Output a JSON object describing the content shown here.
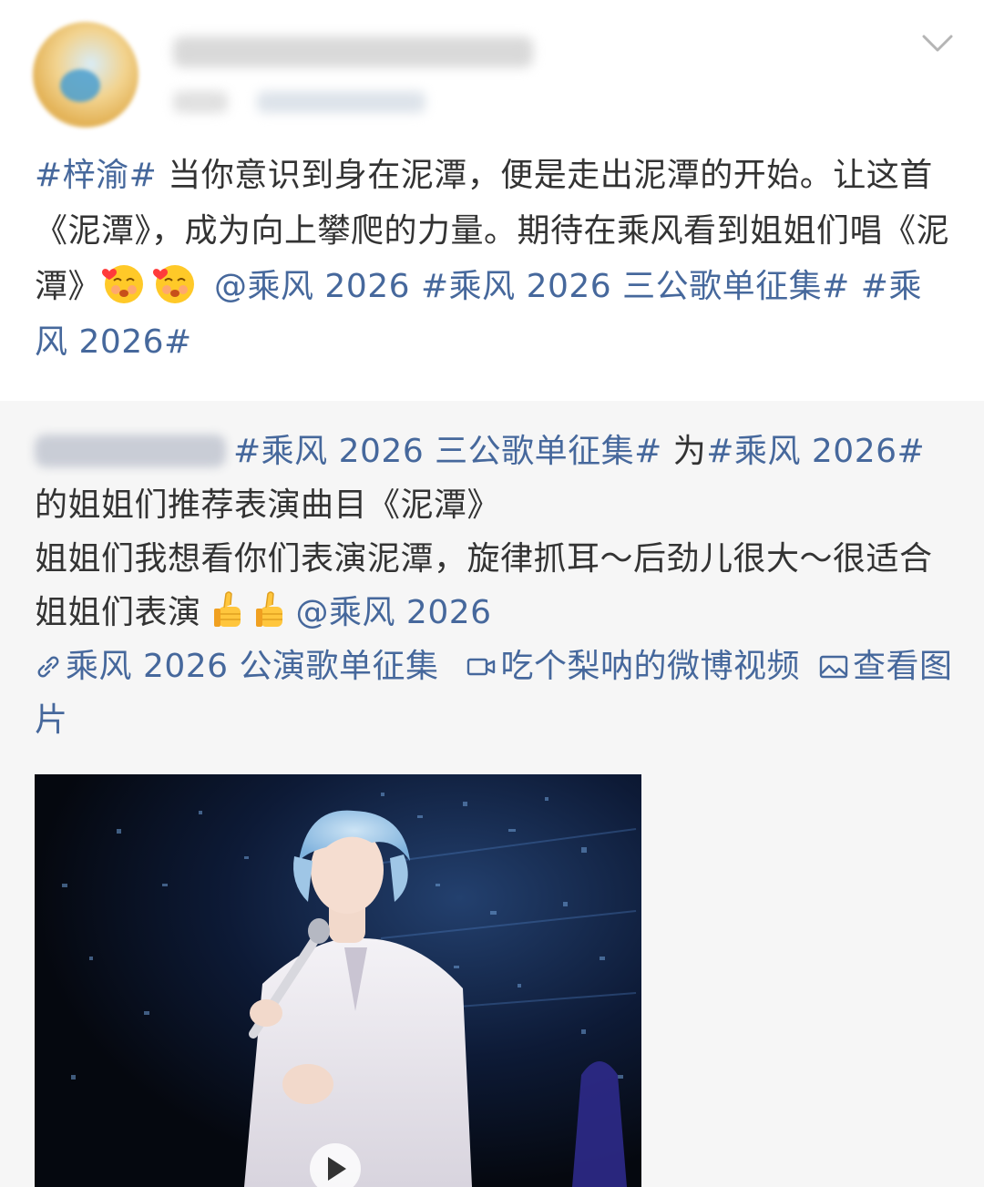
{
  "post": {
    "tag_ziyu": "#梓渝#",
    "text_1": " 当你意识到身在泥潭，便是走出泥潭的开始。让这首《泥潭》，成为向上攀爬的力量。期待在乘风看到姐姐们唱《泥潭》",
    "mention": "@乘风 2026",
    "tag_collection": "#乘风 2026 三公歌单征集#",
    "tag_show": "#乘风 2026#"
  },
  "repost": {
    "tag_collection": "#乘风 2026 三公歌单征集#",
    "text_for": " 为",
    "tag_show": "#乘风 2026#",
    "text_recommend": "的姐姐们推荐表演曲目《泥潭》",
    "text_wish": "姐姐们我想看你们表演泥潭，旋律抓耳～后劲儿很大～很适合姐姐们表演",
    "mention": "@乘风 2026",
    "link_collection": "乘风 2026 公演歌单征集",
    "link_video": "吃个梨呐的微博视频",
    "link_image": "查看图片"
  },
  "icons": {
    "chevron": "chevron-down-icon",
    "emoji": "shy-blush-emoji-icon",
    "thumbs": "thumbs-up-icon",
    "link": "link-icon",
    "video": "video-icon",
    "image": "image-icon"
  },
  "colors": {
    "link_blue": "#46689c",
    "text": "#333333",
    "repost_bg": "#f6f6f6"
  }
}
